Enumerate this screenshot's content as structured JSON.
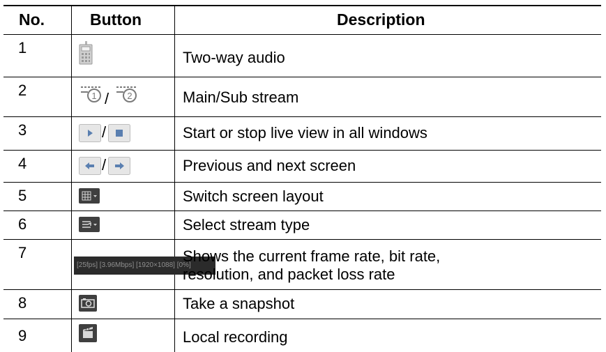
{
  "table": {
    "headers": {
      "no": "No.",
      "button": "Button",
      "description": "Description"
    },
    "rows": [
      {
        "no": "1",
        "icon": "two-way-audio-icon",
        "description": "Two-way audio"
      },
      {
        "no": "2",
        "icon": "main-sub-stream-icon",
        "separator": "/",
        "description": "Main/Sub stream"
      },
      {
        "no": "3",
        "icon": "start-stop-live-view-icon",
        "separator": "/",
        "description": "Start or stop live view in all windows"
      },
      {
        "no": "4",
        "icon": "previous-next-screen-icon",
        "separator": "/",
        "description": "Previous and next screen"
      },
      {
        "no": "5",
        "icon": "screen-layout-icon",
        "description": "Switch screen layout"
      },
      {
        "no": "6",
        "icon": "stream-type-icon",
        "description": "Select stream type"
      },
      {
        "no": "7",
        "icon": "status-bar",
        "status_text": "[25fps] [3.96Mbps] [1920×1088] [0%]",
        "description_line1": "Shows the current frame rate, bit rate,",
        "description_line2": "resolution, and packet loss rate"
      },
      {
        "no": "8",
        "icon": "camera-snapshot-icon",
        "description": "Take a snapshot"
      },
      {
        "no": "9",
        "icon": "local-recording-icon",
        "description": "Local recording"
      }
    ]
  },
  "colors": {
    "rule": "#000000",
    "icon_gray": "#9a9a9a",
    "icon_dark": "#4a4a4a",
    "button_face": "#e6e6e6",
    "status_bg": "#2b2b2b"
  }
}
